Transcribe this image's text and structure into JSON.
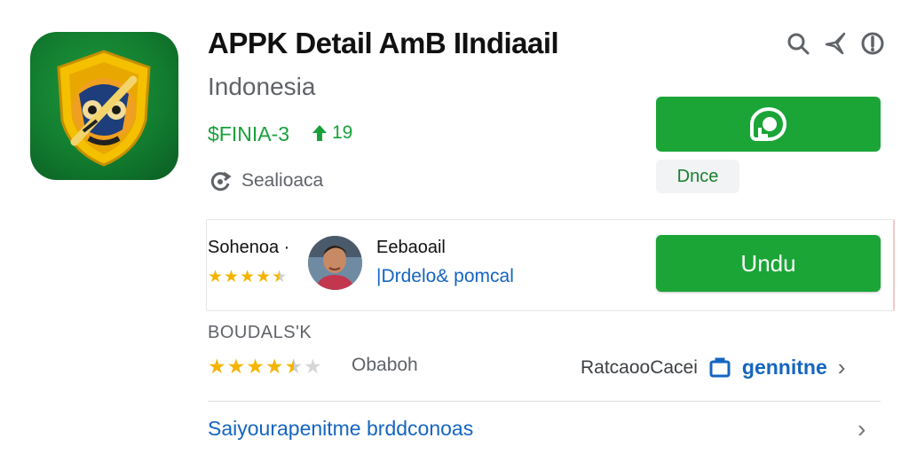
{
  "app": {
    "title": "APPK Detail AmB IIndiaail",
    "subtitle": "Indonesia",
    "price": "$FINIA-3",
    "size": "19",
    "meta": "Sealioaca"
  },
  "actions": {
    "install_chip": "Dnce",
    "download": "Undu"
  },
  "developer": {
    "name": "Sohenoa ·",
    "stars": 4.5
  },
  "reviewer": {
    "name": "Eebaoail",
    "link": "|Drdelo& pomcal"
  },
  "ratings": {
    "section_label": "BOUDALS'K",
    "stars": 4.5,
    "text": "Obaboh",
    "right_text": "RatcaooCacei",
    "right_link": "gennitne"
  },
  "bottom": {
    "link": "Saiyourapenitme brddconoas"
  },
  "icons": {
    "search": "search-icon",
    "share": "share-icon",
    "info": "info-icon",
    "size": "upload-arrow-icon",
    "meta": "refresh-icon",
    "install": "download-badge-icon",
    "shield": "shield-icon",
    "chevron": "chevron-right-icon"
  },
  "colors": {
    "accent_green": "#1aa536",
    "link_blue": "#1565c0",
    "star": "#f4b400"
  }
}
